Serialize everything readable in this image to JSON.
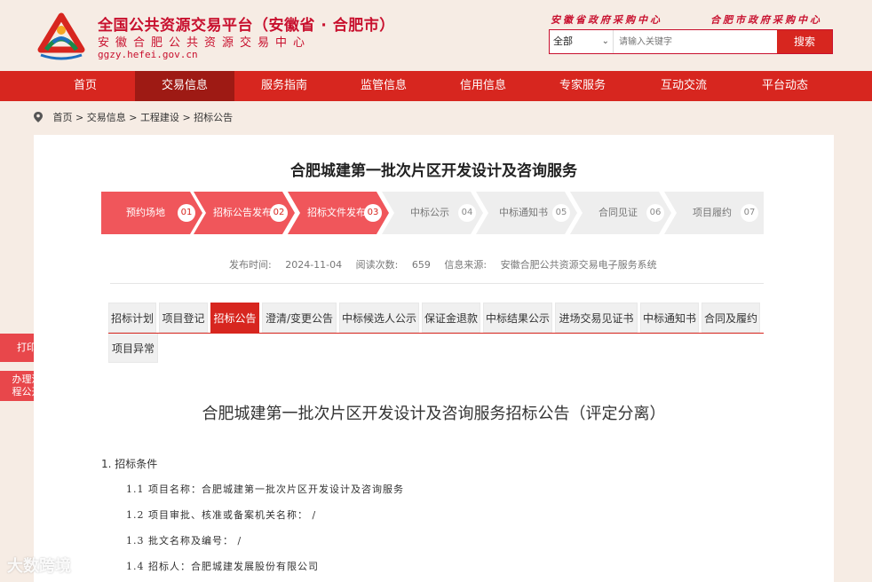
{
  "header": {
    "title": "全国公共资源交易平台（安徽省 · 合肥市）",
    "subtitle": "安徽合肥公共资源交易中心",
    "url": "ggzy.hefei.gov.cn",
    "links": [
      "安徽省政府采购中心",
      "合肥市政府采购中心"
    ],
    "search": {
      "scope": "全部",
      "placeholder": "请输入关键字",
      "button": "搜索"
    }
  },
  "nav": [
    "首页",
    "交易信息",
    "服务指南",
    "监管信息",
    "信用信息",
    "专家服务",
    "互动交流",
    "平台动态"
  ],
  "nav_active": 1,
  "breadcrumb": [
    "首页",
    "交易信息",
    "工程建设",
    "招标公告"
  ],
  "project_title": "合肥城建第一批次片区开发设计及咨询服务",
  "steps": [
    {
      "label": "预约场地",
      "num": "01"
    },
    {
      "label": "招标公告发布",
      "num": "02"
    },
    {
      "label": "招标文件发布",
      "num": "03"
    },
    {
      "label": "中标公示",
      "num": "04"
    },
    {
      "label": "中标通知书",
      "num": "05"
    },
    {
      "label": "合同见证",
      "num": "06"
    },
    {
      "label": "项目履约",
      "num": "07"
    }
  ],
  "steps_done": 3,
  "meta": {
    "publish_label": "发布时间:",
    "publish_date": "2024-11-04",
    "views_label": "阅读次数:",
    "views": "659",
    "source_label": "信息来源:",
    "source": "安徽合肥公共资源交易电子服务系统"
  },
  "tabs": [
    "招标计划",
    "项目登记",
    "招标公告",
    "澄清/变更公告",
    "中标候选人公示",
    "保证金退款",
    "中标结果公示",
    "进场交易见证书",
    "中标通知书",
    "合同及履约",
    "项目异常"
  ],
  "tab_active": 2,
  "side": {
    "print": "打印",
    "flow": "办理流程公开"
  },
  "doc": {
    "title": "合肥城建第一批次片区开发设计及咨询服务招标公告（评定分离）",
    "section": "1.  招标条件",
    "items": [
      "1.1  项目名称：合肥城建第一批次片区开发设计及咨询服务",
      "1.2  项目审批、核准或备案机关名称：  /",
      "1.3  批文名称及编号：  /",
      "1.4  招标人：合肥城建发展股份有限公司"
    ]
  },
  "watermark": "大数跨境",
  "colors": {
    "brand_red": "#d7261f",
    "step_done": "#f0565b",
    "step_todo": "#eeeeee",
    "page_bg": "#f6ece4"
  }
}
